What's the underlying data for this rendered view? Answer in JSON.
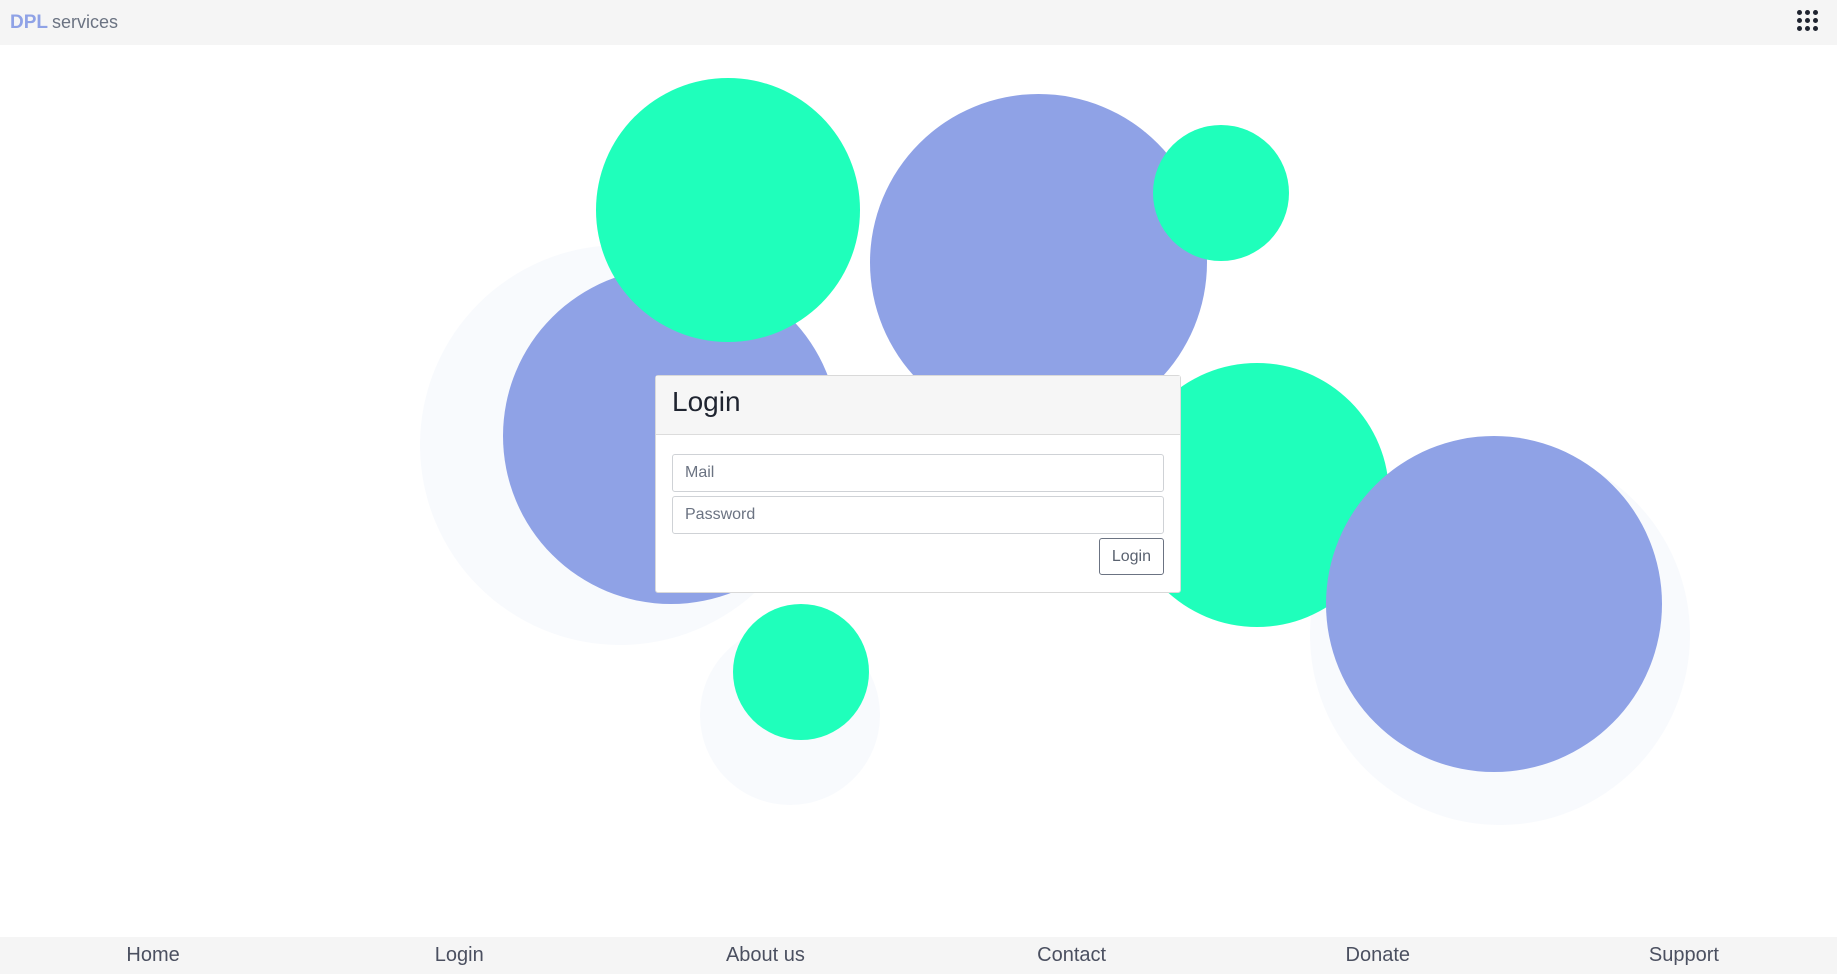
{
  "header": {
    "brand_strong": "DPL",
    "brand_light": "services",
    "apps_icon": "apps-grid-icon"
  },
  "login": {
    "title": "Login",
    "mail_placeholder": "Mail",
    "password_placeholder": "Password",
    "submit_label": "Login"
  },
  "footer": {
    "items": [
      "Home",
      "Login",
      "About us",
      "Contact",
      "Donate",
      "Support"
    ]
  },
  "colors": {
    "accent_purple": "#8fa2e6",
    "accent_mint": "#1fffbb",
    "bar_background": "#f5f5f5"
  }
}
